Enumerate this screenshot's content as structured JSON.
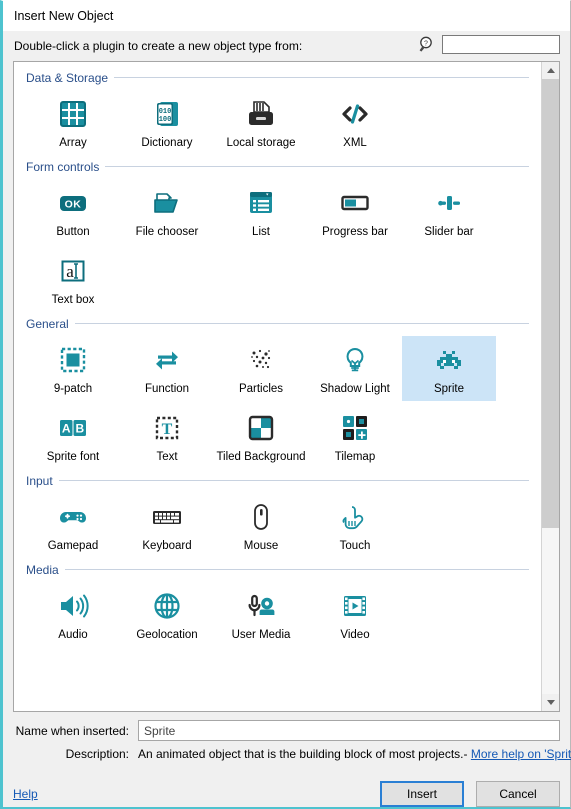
{
  "window": {
    "title": "Insert New Object"
  },
  "header": {
    "prompt": "Double-click a plugin to create a new object type from:",
    "search_placeholder": "",
    "search_value": "",
    "search_icon": "search-help-icon"
  },
  "accent": {
    "teal": "#1a8fa0",
    "dark_teal": "#0d6e7d",
    "group_label": "#2a4f8a",
    "selection": "#cce4f7",
    "link": "#1559b5"
  },
  "groups": [
    {
      "label": "Data & Storage",
      "items": [
        {
          "label": "Array",
          "icon": "array-icon",
          "selected": false
        },
        {
          "label": "Dictionary",
          "icon": "dictionary-icon",
          "selected": false
        },
        {
          "label": "Local storage",
          "icon": "local-storage-icon",
          "selected": false
        },
        {
          "label": "XML",
          "icon": "xml-icon",
          "selected": false
        }
      ]
    },
    {
      "label": "Form controls",
      "items": [
        {
          "label": "Button",
          "icon": "button-ok-icon",
          "selected": false
        },
        {
          "label": "File chooser",
          "icon": "file-chooser-icon",
          "selected": false
        },
        {
          "label": "List",
          "icon": "list-icon",
          "selected": false
        },
        {
          "label": "Progress bar",
          "icon": "progress-bar-icon",
          "selected": false
        },
        {
          "label": "Slider bar",
          "icon": "slider-bar-icon",
          "selected": false
        },
        {
          "label": "Text box",
          "icon": "text-box-icon",
          "selected": false
        }
      ]
    },
    {
      "label": "General",
      "items": [
        {
          "label": "9-patch",
          "icon": "nine-patch-icon",
          "selected": false
        },
        {
          "label": "Function",
          "icon": "function-icon",
          "selected": false
        },
        {
          "label": "Particles",
          "icon": "particles-icon",
          "selected": false
        },
        {
          "label": "Shadow Light",
          "icon": "shadow-light-icon",
          "selected": false
        },
        {
          "label": "Sprite",
          "icon": "sprite-icon",
          "selected": true
        },
        {
          "label": "Sprite font",
          "icon": "sprite-font-icon",
          "selected": false
        },
        {
          "label": "Text",
          "icon": "text-icon",
          "selected": false
        },
        {
          "label": "Tiled Background",
          "icon": "tiled-background-icon",
          "selected": false
        },
        {
          "label": "Tilemap",
          "icon": "tilemap-icon",
          "selected": false
        }
      ]
    },
    {
      "label": "Input",
      "items": [
        {
          "label": "Gamepad",
          "icon": "gamepad-icon",
          "selected": false
        },
        {
          "label": "Keyboard",
          "icon": "keyboard-icon",
          "selected": false
        },
        {
          "label": "Mouse",
          "icon": "mouse-icon",
          "selected": false
        },
        {
          "label": "Touch",
          "icon": "touch-icon",
          "selected": false
        }
      ]
    },
    {
      "label": "Media",
      "items": [
        {
          "label": "Audio",
          "icon": "audio-icon",
          "selected": false
        },
        {
          "label": "Geolocation",
          "icon": "geolocation-icon",
          "selected": false
        },
        {
          "label": "User Media",
          "icon": "user-media-icon",
          "selected": false
        },
        {
          "label": "Video",
          "icon": "video-icon",
          "selected": false
        }
      ]
    }
  ],
  "footer": {
    "name_label": "Name when inserted:",
    "name_value": "Sprite",
    "name_placeholder": "",
    "description_label": "Description:",
    "description_text": "An animated object that is the building block of most projects.",
    "description_separator": "-",
    "description_link": "More help on 'Sprite'",
    "help_link": "Help",
    "insert_button": "Insert",
    "cancel_button": "Cancel"
  },
  "scrollbar": {
    "thumb_percent": 73
  }
}
